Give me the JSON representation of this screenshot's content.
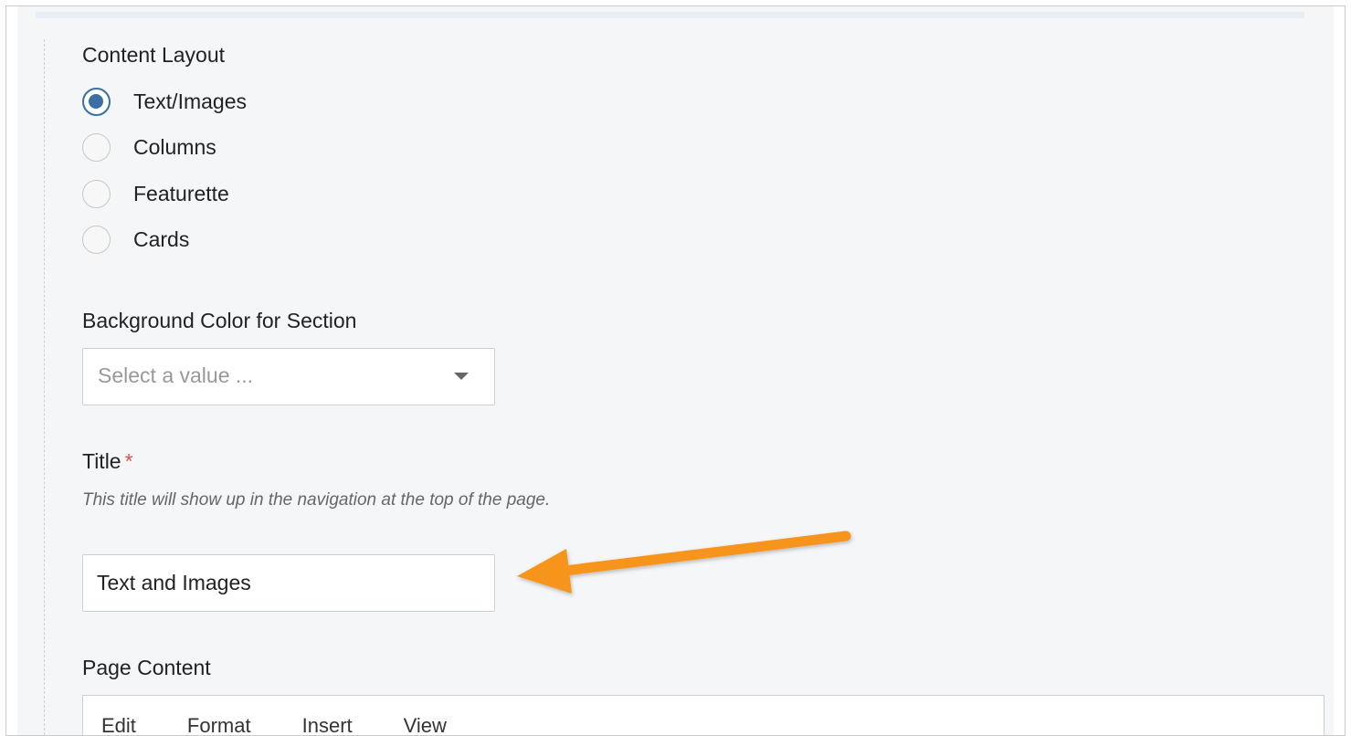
{
  "content_layout": {
    "label": "Content Layout",
    "options": [
      {
        "label": "Text/Images",
        "checked": true
      },
      {
        "label": "Columns",
        "checked": false
      },
      {
        "label": "Featurette",
        "checked": false
      },
      {
        "label": "Cards",
        "checked": false
      }
    ]
  },
  "background_color": {
    "label": "Background Color for Section",
    "placeholder": "Select a value ..."
  },
  "title_field": {
    "label": "Title",
    "required_mark": "*",
    "help": "This title will show up in the navigation at the top of the page.",
    "value": "Text and Images"
  },
  "page_content": {
    "label": "Page Content",
    "menu": [
      "Edit",
      "Format",
      "Insert",
      "View"
    ]
  },
  "colors": {
    "accent": "#3a6ea5",
    "required": "#d9534f",
    "annotation_arrow": "#f7941d"
  },
  "icons": {
    "select_caret": "chevron-down-icon",
    "annotation": "arrow-left-icon"
  }
}
